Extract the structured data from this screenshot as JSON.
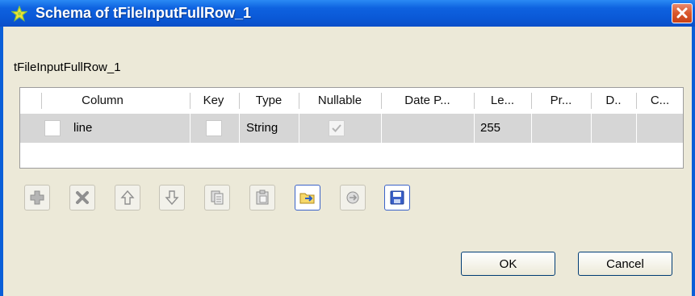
{
  "window": {
    "title": "Schema of tFileInputFullRow_1"
  },
  "component_label": "tFileInputFullRow_1",
  "table": {
    "headers": [
      "Column",
      "Key",
      "Type",
      "Nullable",
      "Date P...",
      "Le...",
      "Pr...",
      "D..",
      "C..."
    ],
    "rows": [
      {
        "column": "line",
        "key": false,
        "type": "String",
        "nullable": true,
        "date_pattern": "",
        "length": "255",
        "precision": "",
        "default": "",
        "comment": ""
      }
    ]
  },
  "toolbar": {
    "buttons": [
      {
        "name": "add-icon",
        "enabled": false
      },
      {
        "name": "delete-icon",
        "enabled": false
      },
      {
        "name": "move-up-icon",
        "enabled": false
      },
      {
        "name": "move-down-icon",
        "enabled": false
      },
      {
        "name": "copy-icon",
        "enabled": false
      },
      {
        "name": "paste-icon",
        "enabled": false
      },
      {
        "name": "import-icon",
        "enabled": true
      },
      {
        "name": "export-icon",
        "enabled": false
      },
      {
        "name": "save-icon",
        "enabled": true
      }
    ]
  },
  "buttons": {
    "ok_label": "OK",
    "cancel_label": "Cancel"
  },
  "colors": {
    "titlebar": "#0a58d6",
    "dialog_bg": "#ece9d8",
    "selected_row": "#d6d6d6",
    "close": "#d9572b"
  }
}
